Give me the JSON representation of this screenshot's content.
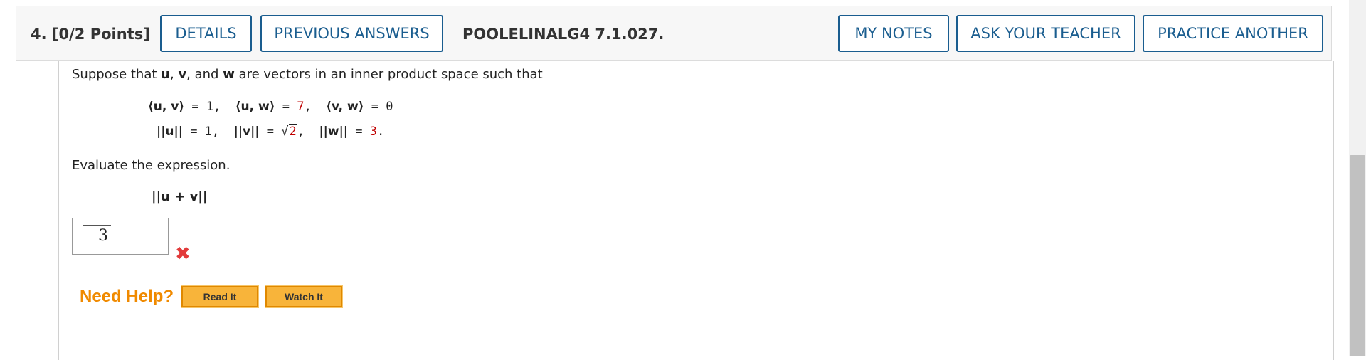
{
  "header": {
    "question_number": "4.",
    "points": "[0/2 Points]",
    "buttons": {
      "details": "DETAILS",
      "previous_answers": "PREVIOUS ANSWERS",
      "my_notes": "MY NOTES",
      "ask_teacher": "ASK YOUR TEACHER",
      "practice_another": "PRACTICE ANOTHER"
    },
    "question_id": "POOLELINALG4 7.1.027."
  },
  "problem": {
    "intro_1": "Suppose that ",
    "u": "u",
    "sep_1": ", ",
    "v": "v",
    "sep_2": ", and ",
    "w": "w",
    "intro_2": " are vectors in an inner product space such that",
    "line1": {
      "uv_lhs": "⟨u, v⟩",
      "uv_rhs": " = 1,  ",
      "uw_lhs": "⟨u, w⟩",
      "uw_eq": " = ",
      "uw_val": "7",
      "uw_sep": ",  ",
      "vw_lhs": "⟨v, w⟩",
      "vw_rhs": " = 0"
    },
    "line2": {
      "u_norm_lhs": "||u||",
      "u_norm_rhs": " = 1,  ",
      "v_norm_lhs": "||v||",
      "v_norm_eq": " = ",
      "sqrt_sign": "√",
      "v_norm_val": "2",
      "v_norm_sep": ",  ",
      "w_norm_lhs": "||w||",
      "w_norm_eq": " = ",
      "w_norm_val": "3",
      "w_norm_end": "."
    },
    "evaluate_text": "Evaluate the expression.",
    "expression": "||u + v||"
  },
  "answer": {
    "value": "3",
    "status_icon": "x-mark-icon",
    "status_color": "#e23b3b"
  },
  "help": {
    "label": "Need Help?",
    "read_it": "Read It",
    "watch_it": "Watch It"
  },
  "colors": {
    "accent": "#1a5d8f",
    "highlight_red": "#c00000",
    "help_orange": "#f08a00",
    "help_button": "#f8b43a"
  }
}
